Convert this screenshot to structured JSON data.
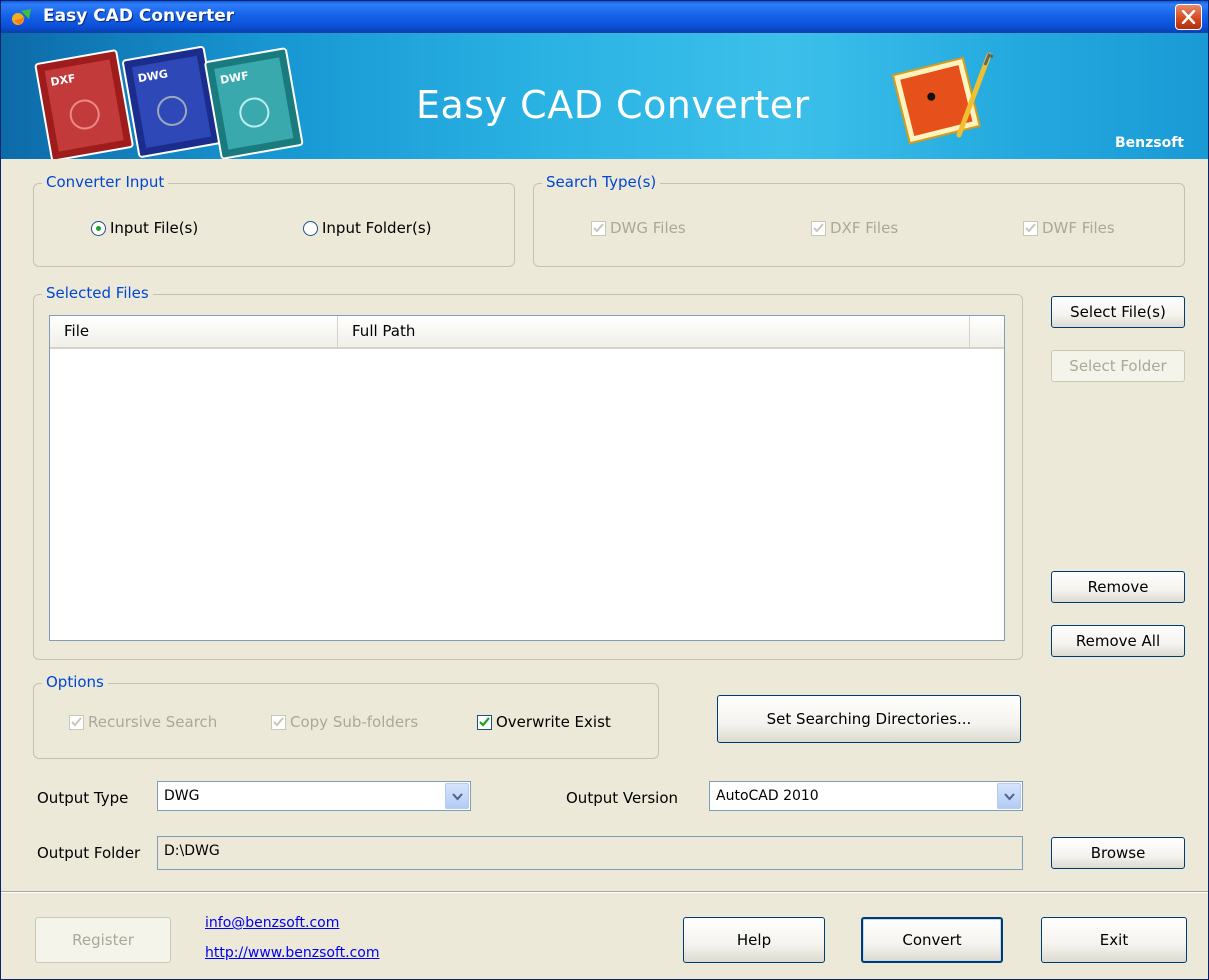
{
  "window": {
    "title": "Easy CAD Converter"
  },
  "banner": {
    "title": "Easy CAD Converter",
    "brand": "Benzsoft",
    "doc_labels": [
      "DXF",
      "DWG",
      "DWF"
    ]
  },
  "converter_input": {
    "legend": "Converter Input",
    "options": [
      {
        "label": "Input File(s)",
        "selected": true
      },
      {
        "label": "Input Folder(s)",
        "selected": false
      }
    ]
  },
  "search_types": {
    "legend": "Search Type(s)",
    "items": [
      {
        "label": "DWG Files",
        "checked": true,
        "enabled": false
      },
      {
        "label": "DXF Files",
        "checked": true,
        "enabled": false
      },
      {
        "label": "DWF Files",
        "checked": true,
        "enabled": false
      }
    ]
  },
  "selected_files": {
    "legend": "Selected Files",
    "columns": [
      "File",
      "Full Path"
    ],
    "rows": []
  },
  "side_buttons": {
    "select_files": "Select File(s)",
    "select_folder": "Select Folder",
    "remove": "Remove",
    "remove_all": "Remove All"
  },
  "options": {
    "legend": "Options",
    "items": [
      {
        "label": "Recursive Search",
        "checked": true,
        "enabled": false
      },
      {
        "label": "Copy Sub-folders",
        "checked": true,
        "enabled": false
      },
      {
        "label": "Overwrite Exist",
        "checked": true,
        "enabled": true
      }
    ],
    "set_dirs_button": "Set Searching Directories..."
  },
  "output": {
    "type_label": "Output Type",
    "type_value": "DWG",
    "version_label": "Output Version",
    "version_value": "AutoCAD 2010",
    "folder_label": "Output Folder",
    "folder_value": "D:\\DWG",
    "browse_button": "Browse"
  },
  "footer": {
    "register_button": "Register",
    "email_link": "info@benzsoft.com",
    "web_link": "http://www.benzsoft.com",
    "help_button": "Help",
    "convert_button": "Convert",
    "exit_button": "Exit"
  },
  "colors": {
    "accent": "#0046d5",
    "window_bg": "#ece9d8",
    "title_bar": "#0b4fd8",
    "banner": "#2ab2e3"
  }
}
